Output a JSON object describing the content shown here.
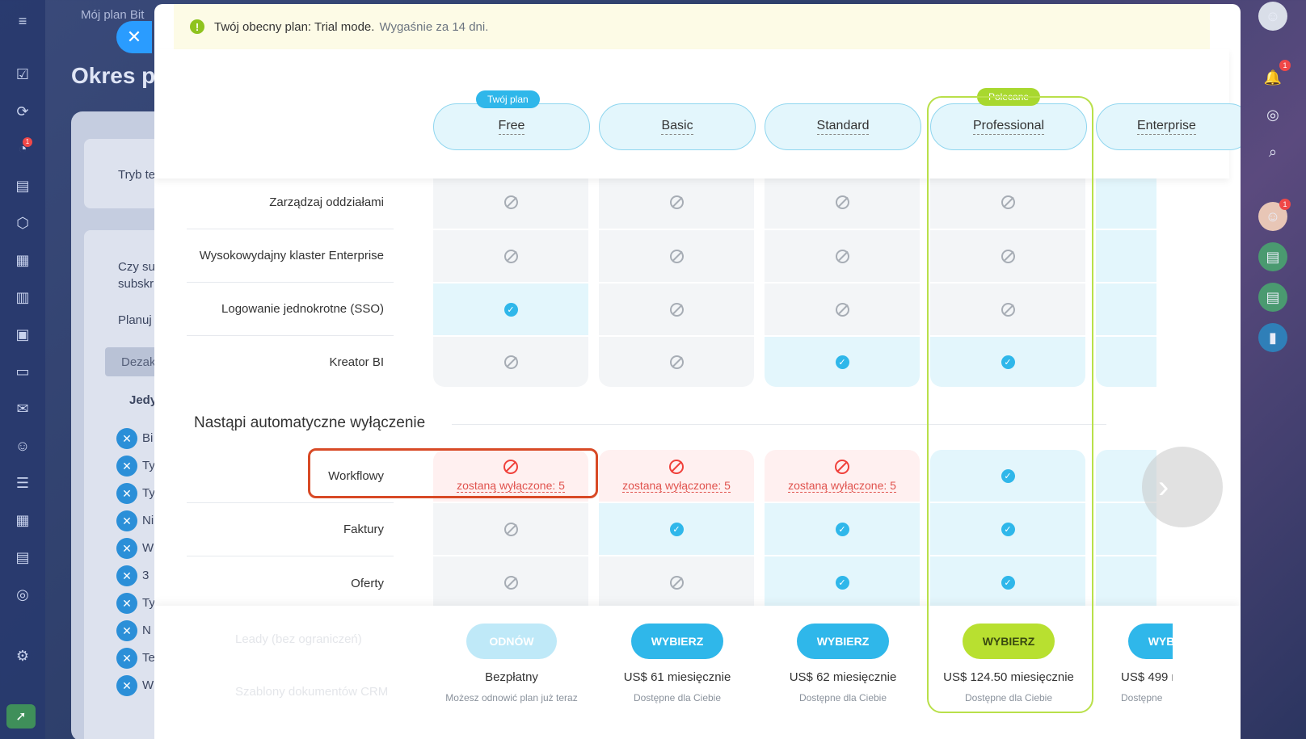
{
  "background": {
    "top_title": "Mój plan Bit",
    "page_title": "Okres pr",
    "tryb": "Tryb te",
    "question_line1": "Czy su",
    "question_line2": "subskr",
    "planuj": "Planuj",
    "deactivate_btn": "Dezak",
    "jedy": "Jedy",
    "list_items": [
      "Bi",
      "Ty",
      "Ty",
      "Ni",
      "W",
      "3",
      "Ty",
      "N",
      "Te",
      "W"
    ]
  },
  "notice": {
    "text": "Twój obecny plan: Trial mode.",
    "muted": "Wygaśnie za 14 dni."
  },
  "plans": [
    {
      "name": "Free",
      "tag": "Twój plan"
    },
    {
      "name": "Basic",
      "tag": ""
    },
    {
      "name": "Standard",
      "tag": ""
    },
    {
      "name": "Professional",
      "tag": "Polecane"
    },
    {
      "name": "Enterprise",
      "tag": ""
    }
  ],
  "rows": [
    {
      "label": "Zarządzaj oddziałami",
      "values": [
        "no",
        "no",
        "no",
        "no",
        "yes"
      ]
    },
    {
      "label": "Wysokowydajny klaster Enterprise",
      "values": [
        "no",
        "no",
        "no",
        "no",
        "yes"
      ]
    },
    {
      "label": "Logowanie jednokrotne (SSO)",
      "values": [
        "yes",
        "no",
        "no",
        "no",
        "yes"
      ]
    },
    {
      "label": "Kreator BI",
      "values": [
        "no",
        "no",
        "yes",
        "yes",
        "yes"
      ]
    }
  ],
  "section": {
    "title": "Nastąpi automatyczne wyłączenie",
    "rows": [
      {
        "label": "Workflowy",
        "values": [
          "off",
          "off",
          "off",
          "yes",
          "yes"
        ]
      },
      {
        "label": "Faktury",
        "values": [
          "no",
          "yes",
          "yes",
          "yes",
          "yes"
        ]
      },
      {
        "label": "Oferty",
        "values": [
          "no",
          "no",
          "yes",
          "yes",
          "yes"
        ]
      }
    ],
    "off_text": "zostaną wyłączone: 5"
  },
  "footer": {
    "ghost_rows": [
      "Leady (bez ograniczeń)",
      "Szablony dokumentów CRM"
    ],
    "plans": [
      {
        "button": "ODNÓW",
        "price": "Bezpłatny",
        "note": "Możesz odnowić plan już teraz"
      },
      {
        "button": "WYBIERZ",
        "price": "US$ 61 miesięcznie",
        "note": "Dostępne dla Ciebie"
      },
      {
        "button": "WYBIERZ",
        "price": "US$ 62 miesięcznie",
        "note": "Dostępne dla Ciebie"
      },
      {
        "button": "WYBIERZ",
        "price": "US$ 124.50 miesięcznie",
        "note": "Dostępne dla Ciebie"
      },
      {
        "button": "WYBIERZ",
        "price": "US$ 499 m",
        "note": "Dostępne"
      }
    ]
  },
  "badges": {
    "chat": "1",
    "notifications": "1",
    "avatar2": "1"
  },
  "colors": {
    "accent": "#2fb7ea",
    "recommended": "#b9e04a",
    "highlight": "#d84a26",
    "off": "#f0413b"
  }
}
